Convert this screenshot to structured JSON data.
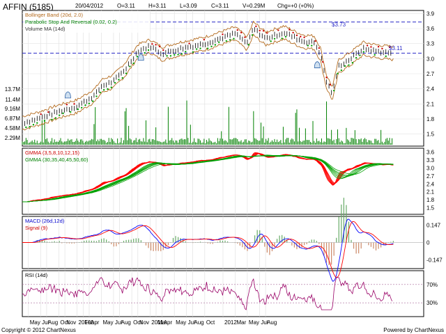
{
  "header": {
    "symbol": "AFFIN (5185)",
    "date": "20/04/2012",
    "open": "O=3.11",
    "high": "H=3.11",
    "low": "L=3.09",
    "close": "C=3.11",
    "volume": "V=0.29M",
    "change": "Chg=+0 (+0%)"
  },
  "footer": {
    "copyright": "Copyright © 2012 ChartNexus",
    "powered": "Powered by ChartNexus"
  },
  "colors": {
    "bollinger": "#b36a1d",
    "sar_up": "#00a000",
    "sar_down": "#cc0000",
    "volume": "#008000",
    "level_line": "#2a2ac8",
    "gmma_short": "#ff0000",
    "gmma_long": "#00a000",
    "macd": "#0000ff",
    "signal": "#ff0000",
    "rsi": "#990066"
  },
  "chart_data": [
    {
      "type": "line",
      "panel": "price",
      "legend": [
        "Bollinger Band (20d, 2.0)",
        "Parabolic Stop And Reversal (0.02, 0.2)",
        "Volume MA (14d)"
      ],
      "y_ticks": [
        "3.9",
        "3.6",
        "3.3",
        "3.0",
        "2.7",
        "2.4",
        "2.1",
        "1.8",
        "1.5"
      ],
      "y_tick_values": [
        3.9,
        3.6,
        3.3,
        3.0,
        2.7,
        2.4,
        2.1,
        1.8,
        1.5
      ],
      "ylim": [
        1.26,
        3.96
      ],
      "volume_ticks": [
        "13.7M",
        "11.4M",
        "9.16M",
        "6.87M",
        "4.58M",
        "2.29M"
      ],
      "levels": [
        {
          "label": "$3.73",
          "value": 3.73
        },
        {
          "label": "$3.11",
          "value": 3.11
        }
      ],
      "price_anchors": [
        [
          0,
          1.72
        ],
        [
          3,
          1.82
        ],
        [
          6,
          1.95
        ],
        [
          9,
          2.05
        ],
        [
          12,
          2.28
        ],
        [
          13,
          2.45
        ],
        [
          15,
          2.55
        ],
        [
          17,
          2.8
        ],
        [
          19,
          3.15
        ],
        [
          21,
          3.25
        ],
        [
          23,
          3.1
        ],
        [
          26,
          3.2
        ],
        [
          30,
          3.3
        ],
        [
          33,
          3.42
        ],
        [
          35,
          3.5
        ],
        [
          37,
          3.3
        ],
        [
          38,
          3.6
        ],
        [
          40,
          3.4
        ],
        [
          43,
          3.52
        ],
        [
          46,
          3.35
        ],
        [
          48,
          3.32
        ],
        [
          49,
          3.1
        ],
        [
          50,
          2.55
        ],
        [
          51,
          2.3
        ],
        [
          52,
          2.85
        ],
        [
          54,
          3.0
        ],
        [
          56,
          3.2
        ],
        [
          58,
          3.15
        ],
        [
          60,
          3.12
        ],
        [
          61,
          3.11
        ]
      ],
      "volume_spike_months": [
        12,
        17,
        24,
        27,
        34,
        38,
        45,
        50
      ]
    },
    {
      "type": "line",
      "panel": "gmma",
      "legend": [
        "GMMA (3,5,8,10,12,15)",
        "GMMA (30,35,40,45,50,60)"
      ],
      "y_ticks": [
        "3.6",
        "3.3",
        "3.0",
        "2.7",
        "2.4",
        "2.1",
        "1.8",
        "1.5"
      ],
      "y_tick_values": [
        3.6,
        3.3,
        3.0,
        2.7,
        2.4,
        2.1,
        1.8,
        1.5
      ],
      "ylim": [
        1.25,
        3.75
      ]
    },
    {
      "type": "line",
      "panel": "macd",
      "legend": [
        "MACD (26d,12d)",
        "Signal (9)"
      ],
      "y_ticks": [
        "0.147",
        "0",
        "-0.147"
      ],
      "y_tick_values": [
        0.147,
        0,
        -0.147
      ],
      "ylim": [
        -0.22,
        0.22
      ]
    },
    {
      "type": "line",
      "panel": "rsi",
      "legend": [
        "RSI (14d)"
      ],
      "y_ticks": [
        "70%",
        "30%"
      ],
      "y_tick_values": [
        70,
        30
      ],
      "ylim": [
        0,
        100
      ]
    }
  ],
  "x_axis": {
    "months_shown": 66,
    "labels": [
      {
        "m": 1,
        "t": "May"
      },
      {
        "m": 3,
        "t": "Jul"
      },
      {
        "m": 4,
        "t": "Aug"
      },
      {
        "m": 6,
        "t": "Oct"
      },
      {
        "m": 7,
        "t": "Nov"
      },
      {
        "m": 9,
        "t": "2010"
      },
      {
        "m": 10,
        "t": "Feb"
      },
      {
        "m": 11,
        "t": "Apr"
      },
      {
        "m": 13,
        "t": "May"
      },
      {
        "m": 15,
        "t": "Jul"
      },
      {
        "m": 16,
        "t": "Aug"
      },
      {
        "m": 18,
        "t": "Oct"
      },
      {
        "m": 19,
        "t": "Nov"
      },
      {
        "m": 21,
        "t": "2011"
      },
      {
        "m": 22,
        "t": "Mar"
      },
      {
        "m": 23,
        "t": "Apr"
      },
      {
        "m": 25,
        "t": "May"
      },
      {
        "m": 27,
        "t": "Jul"
      },
      {
        "m": 28,
        "t": "Aug"
      },
      {
        "m": 30,
        "t": "Oct"
      },
      {
        "m": 33,
        "t": "2012"
      },
      {
        "m": 35,
        "t": "Mar"
      },
      {
        "m": 37,
        "t": "May"
      },
      {
        "m": 39,
        "t": "Jul"
      },
      {
        "m": 40,
        "t": "Aug"
      }
    ]
  }
}
